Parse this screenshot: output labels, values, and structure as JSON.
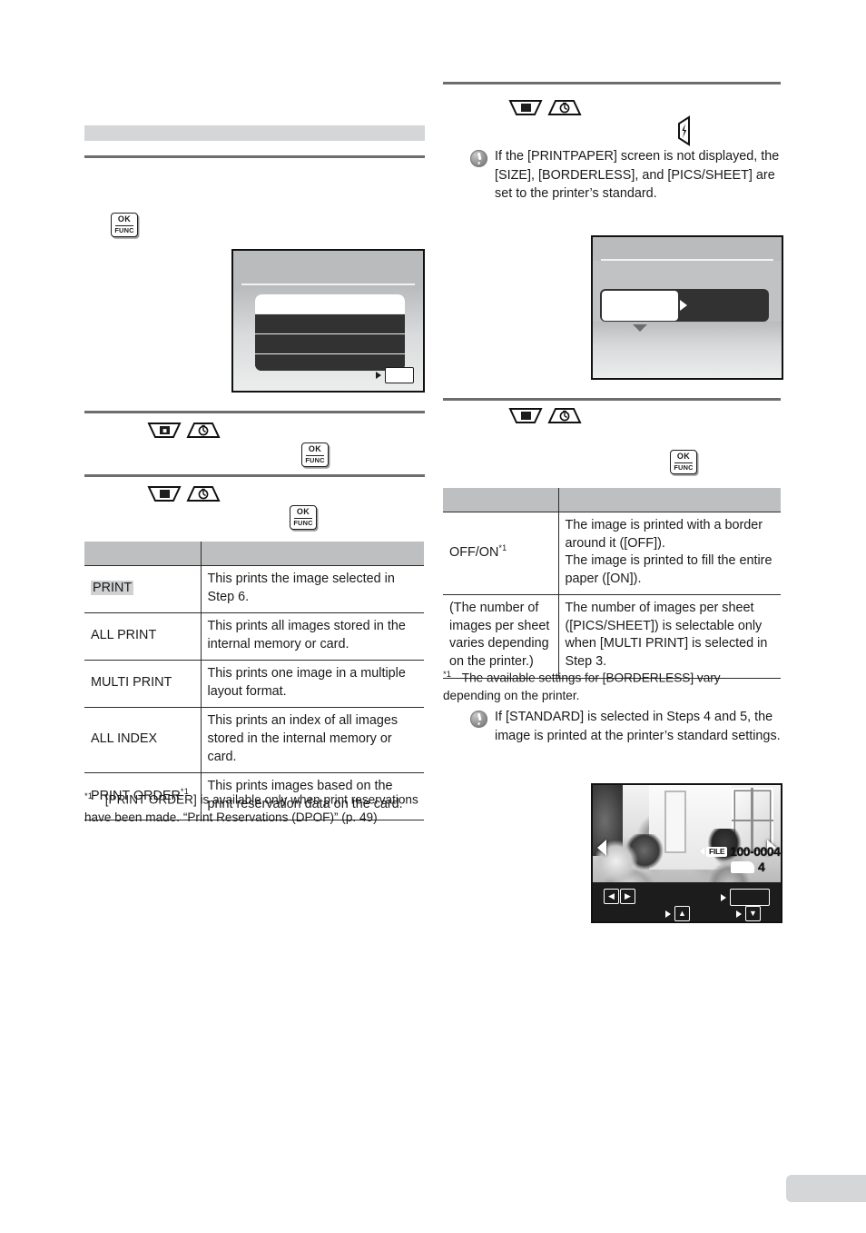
{
  "document": {
    "type": "camera-instruction-manual-page",
    "page_tab_label": ""
  },
  "left_column": {
    "section_heading": "",
    "step_ok_button": {
      "line1": "OK",
      "line2": "FUNC"
    },
    "lcd_menu_screen": {
      "title": "",
      "rows": [
        {
          "label": "",
          "selected": true
        },
        {
          "label": "",
          "selected": false
        },
        {
          "label": "",
          "selected": false
        },
        {
          "label": "",
          "selected": false
        }
      ],
      "hint_label": ""
    },
    "step_pad_icons": [
      {
        "name": "exposure-compensation-down-pad",
        "glyph": "exposure"
      },
      {
        "name": "self-timer-up-pad",
        "glyph": "timer"
      }
    ],
    "table": {
      "headers": [
        "",
        ""
      ],
      "rows": [
        {
          "option": "PRINT",
          "highlighted": true,
          "footnote_mark": "",
          "description": "This prints the image selected in Step 6."
        },
        {
          "option": "ALL PRINT",
          "highlighted": false,
          "footnote_mark": "",
          "description": "This prints all images stored in the internal memory or card."
        },
        {
          "option": "MULTI PRINT",
          "highlighted": false,
          "footnote_mark": "",
          "description": "This prints one image in a multiple layout format."
        },
        {
          "option": "ALL INDEX",
          "highlighted": false,
          "footnote_mark": "",
          "description": "This prints an index of all images stored in the internal memory or card."
        },
        {
          "option": "PRINT ORDER",
          "highlighted": false,
          "footnote_mark": "*1",
          "description": "This prints images based on the print reservation data on the card."
        }
      ]
    },
    "footnote": {
      "mark": "*1",
      "text": "[PRINT ORDER] is available only when print reservations have been made. “Print Reservations (DPOF)” (p. 49)"
    }
  },
  "right_column": {
    "step_pad_icons_top": [
      {
        "name": "exposure-compensation-down-pad",
        "glyph": "exposure"
      },
      {
        "name": "self-timer-up-pad",
        "glyph": "timer"
      }
    ],
    "flash_pad_icon": {
      "name": "flash-left-pad",
      "glyph": "flash"
    },
    "note_top": {
      "text": "If the [PRINTPAPER] screen is not displayed, the [SIZE], [BORDERLESS], and [PICS/SHEET] are set to the printer’s standard."
    },
    "lcd_setting_screen": {
      "title": "",
      "field_value": "",
      "option_value": "",
      "hint_left": "",
      "hint_right": ""
    },
    "step_pad_icons_mid": [
      {
        "name": "exposure-compensation-down-pad",
        "glyph": "exposure"
      },
      {
        "name": "self-timer-up-pad",
        "glyph": "timer"
      }
    ],
    "step_ok_button": {
      "line1": "OK",
      "line2": "FUNC"
    },
    "table": {
      "headers": [
        "",
        ""
      ],
      "rows": [
        {
          "option": "OFF/ON",
          "footnote_mark": "*1",
          "description": "The image is printed with a border around it ([OFF]).\nThe image is printed to fill the entire paper ([ON])."
        },
        {
          "option": "(The number of images per sheet varies depending on the printer.)",
          "footnote_mark": "",
          "description": "The number of images per sheet ([PICS/SHEET]) is selectable only when [MULTI PRINT] is selected in Step 3."
        }
      ]
    },
    "footnote": {
      "mark": "*1",
      "text": "The available settings for [BORDERLESS] vary depending on the printer."
    },
    "note_bottom": {
      "text": "If [STANDARD] is selected in Steps 4 and 5, the image is printed at the printer’s standard settings."
    },
    "photo_screen": {
      "file_tag": "FILE",
      "file_number": "100-0004",
      "card_number": "4",
      "controls": {
        "left_right": "◀▶",
        "up": "▲",
        "down": "▼",
        "label_box": ""
      }
    }
  },
  "colors": {
    "heading_band": "#d4d6d7",
    "rule": "#6d6d6d",
    "table_header": "#bdbfc0",
    "highlight": "#cfd1d2",
    "lcd_body": "#c0c2c3",
    "lcd_menu_dark": "#323232",
    "ink": "#1a1a1a"
  }
}
